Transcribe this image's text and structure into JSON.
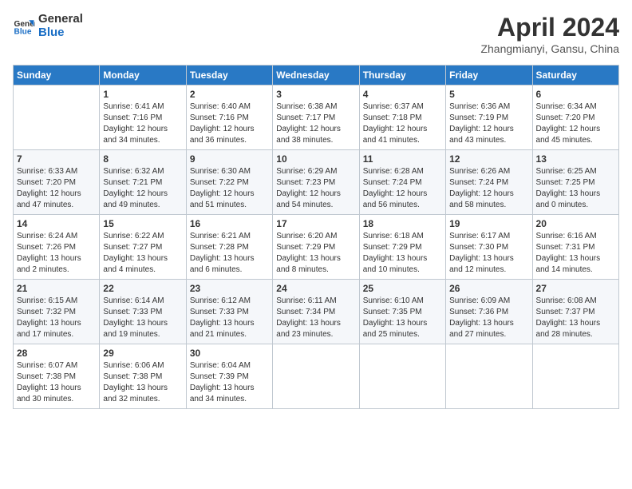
{
  "logo": {
    "line1": "General",
    "line2": "Blue"
  },
  "title": "April 2024",
  "location": "Zhangmianyi, Gansu, China",
  "days_of_week": [
    "Sunday",
    "Monday",
    "Tuesday",
    "Wednesday",
    "Thursday",
    "Friday",
    "Saturday"
  ],
  "weeks": [
    [
      {
        "num": "",
        "info": ""
      },
      {
        "num": "1",
        "info": "Sunrise: 6:41 AM\nSunset: 7:16 PM\nDaylight: 12 hours\nand 34 minutes."
      },
      {
        "num": "2",
        "info": "Sunrise: 6:40 AM\nSunset: 7:16 PM\nDaylight: 12 hours\nand 36 minutes."
      },
      {
        "num": "3",
        "info": "Sunrise: 6:38 AM\nSunset: 7:17 PM\nDaylight: 12 hours\nand 38 minutes."
      },
      {
        "num": "4",
        "info": "Sunrise: 6:37 AM\nSunset: 7:18 PM\nDaylight: 12 hours\nand 41 minutes."
      },
      {
        "num": "5",
        "info": "Sunrise: 6:36 AM\nSunset: 7:19 PM\nDaylight: 12 hours\nand 43 minutes."
      },
      {
        "num": "6",
        "info": "Sunrise: 6:34 AM\nSunset: 7:20 PM\nDaylight: 12 hours\nand 45 minutes."
      }
    ],
    [
      {
        "num": "7",
        "info": "Sunrise: 6:33 AM\nSunset: 7:20 PM\nDaylight: 12 hours\nand 47 minutes."
      },
      {
        "num": "8",
        "info": "Sunrise: 6:32 AM\nSunset: 7:21 PM\nDaylight: 12 hours\nand 49 minutes."
      },
      {
        "num": "9",
        "info": "Sunrise: 6:30 AM\nSunset: 7:22 PM\nDaylight: 12 hours\nand 51 minutes."
      },
      {
        "num": "10",
        "info": "Sunrise: 6:29 AM\nSunset: 7:23 PM\nDaylight: 12 hours\nand 54 minutes."
      },
      {
        "num": "11",
        "info": "Sunrise: 6:28 AM\nSunset: 7:24 PM\nDaylight: 12 hours\nand 56 minutes."
      },
      {
        "num": "12",
        "info": "Sunrise: 6:26 AM\nSunset: 7:24 PM\nDaylight: 12 hours\nand 58 minutes."
      },
      {
        "num": "13",
        "info": "Sunrise: 6:25 AM\nSunset: 7:25 PM\nDaylight: 13 hours\nand 0 minutes."
      }
    ],
    [
      {
        "num": "14",
        "info": "Sunrise: 6:24 AM\nSunset: 7:26 PM\nDaylight: 13 hours\nand 2 minutes."
      },
      {
        "num": "15",
        "info": "Sunrise: 6:22 AM\nSunset: 7:27 PM\nDaylight: 13 hours\nand 4 minutes."
      },
      {
        "num": "16",
        "info": "Sunrise: 6:21 AM\nSunset: 7:28 PM\nDaylight: 13 hours\nand 6 minutes."
      },
      {
        "num": "17",
        "info": "Sunrise: 6:20 AM\nSunset: 7:29 PM\nDaylight: 13 hours\nand 8 minutes."
      },
      {
        "num": "18",
        "info": "Sunrise: 6:18 AM\nSunset: 7:29 PM\nDaylight: 13 hours\nand 10 minutes."
      },
      {
        "num": "19",
        "info": "Sunrise: 6:17 AM\nSunset: 7:30 PM\nDaylight: 13 hours\nand 12 minutes."
      },
      {
        "num": "20",
        "info": "Sunrise: 6:16 AM\nSunset: 7:31 PM\nDaylight: 13 hours\nand 14 minutes."
      }
    ],
    [
      {
        "num": "21",
        "info": "Sunrise: 6:15 AM\nSunset: 7:32 PM\nDaylight: 13 hours\nand 17 minutes."
      },
      {
        "num": "22",
        "info": "Sunrise: 6:14 AM\nSunset: 7:33 PM\nDaylight: 13 hours\nand 19 minutes."
      },
      {
        "num": "23",
        "info": "Sunrise: 6:12 AM\nSunset: 7:33 PM\nDaylight: 13 hours\nand 21 minutes."
      },
      {
        "num": "24",
        "info": "Sunrise: 6:11 AM\nSunset: 7:34 PM\nDaylight: 13 hours\nand 23 minutes."
      },
      {
        "num": "25",
        "info": "Sunrise: 6:10 AM\nSunset: 7:35 PM\nDaylight: 13 hours\nand 25 minutes."
      },
      {
        "num": "26",
        "info": "Sunrise: 6:09 AM\nSunset: 7:36 PM\nDaylight: 13 hours\nand 27 minutes."
      },
      {
        "num": "27",
        "info": "Sunrise: 6:08 AM\nSunset: 7:37 PM\nDaylight: 13 hours\nand 28 minutes."
      }
    ],
    [
      {
        "num": "28",
        "info": "Sunrise: 6:07 AM\nSunset: 7:38 PM\nDaylight: 13 hours\nand 30 minutes."
      },
      {
        "num": "29",
        "info": "Sunrise: 6:06 AM\nSunset: 7:38 PM\nDaylight: 13 hours\nand 32 minutes."
      },
      {
        "num": "30",
        "info": "Sunrise: 6:04 AM\nSunset: 7:39 PM\nDaylight: 13 hours\nand 34 minutes."
      },
      {
        "num": "",
        "info": ""
      },
      {
        "num": "",
        "info": ""
      },
      {
        "num": "",
        "info": ""
      },
      {
        "num": "",
        "info": ""
      }
    ]
  ]
}
